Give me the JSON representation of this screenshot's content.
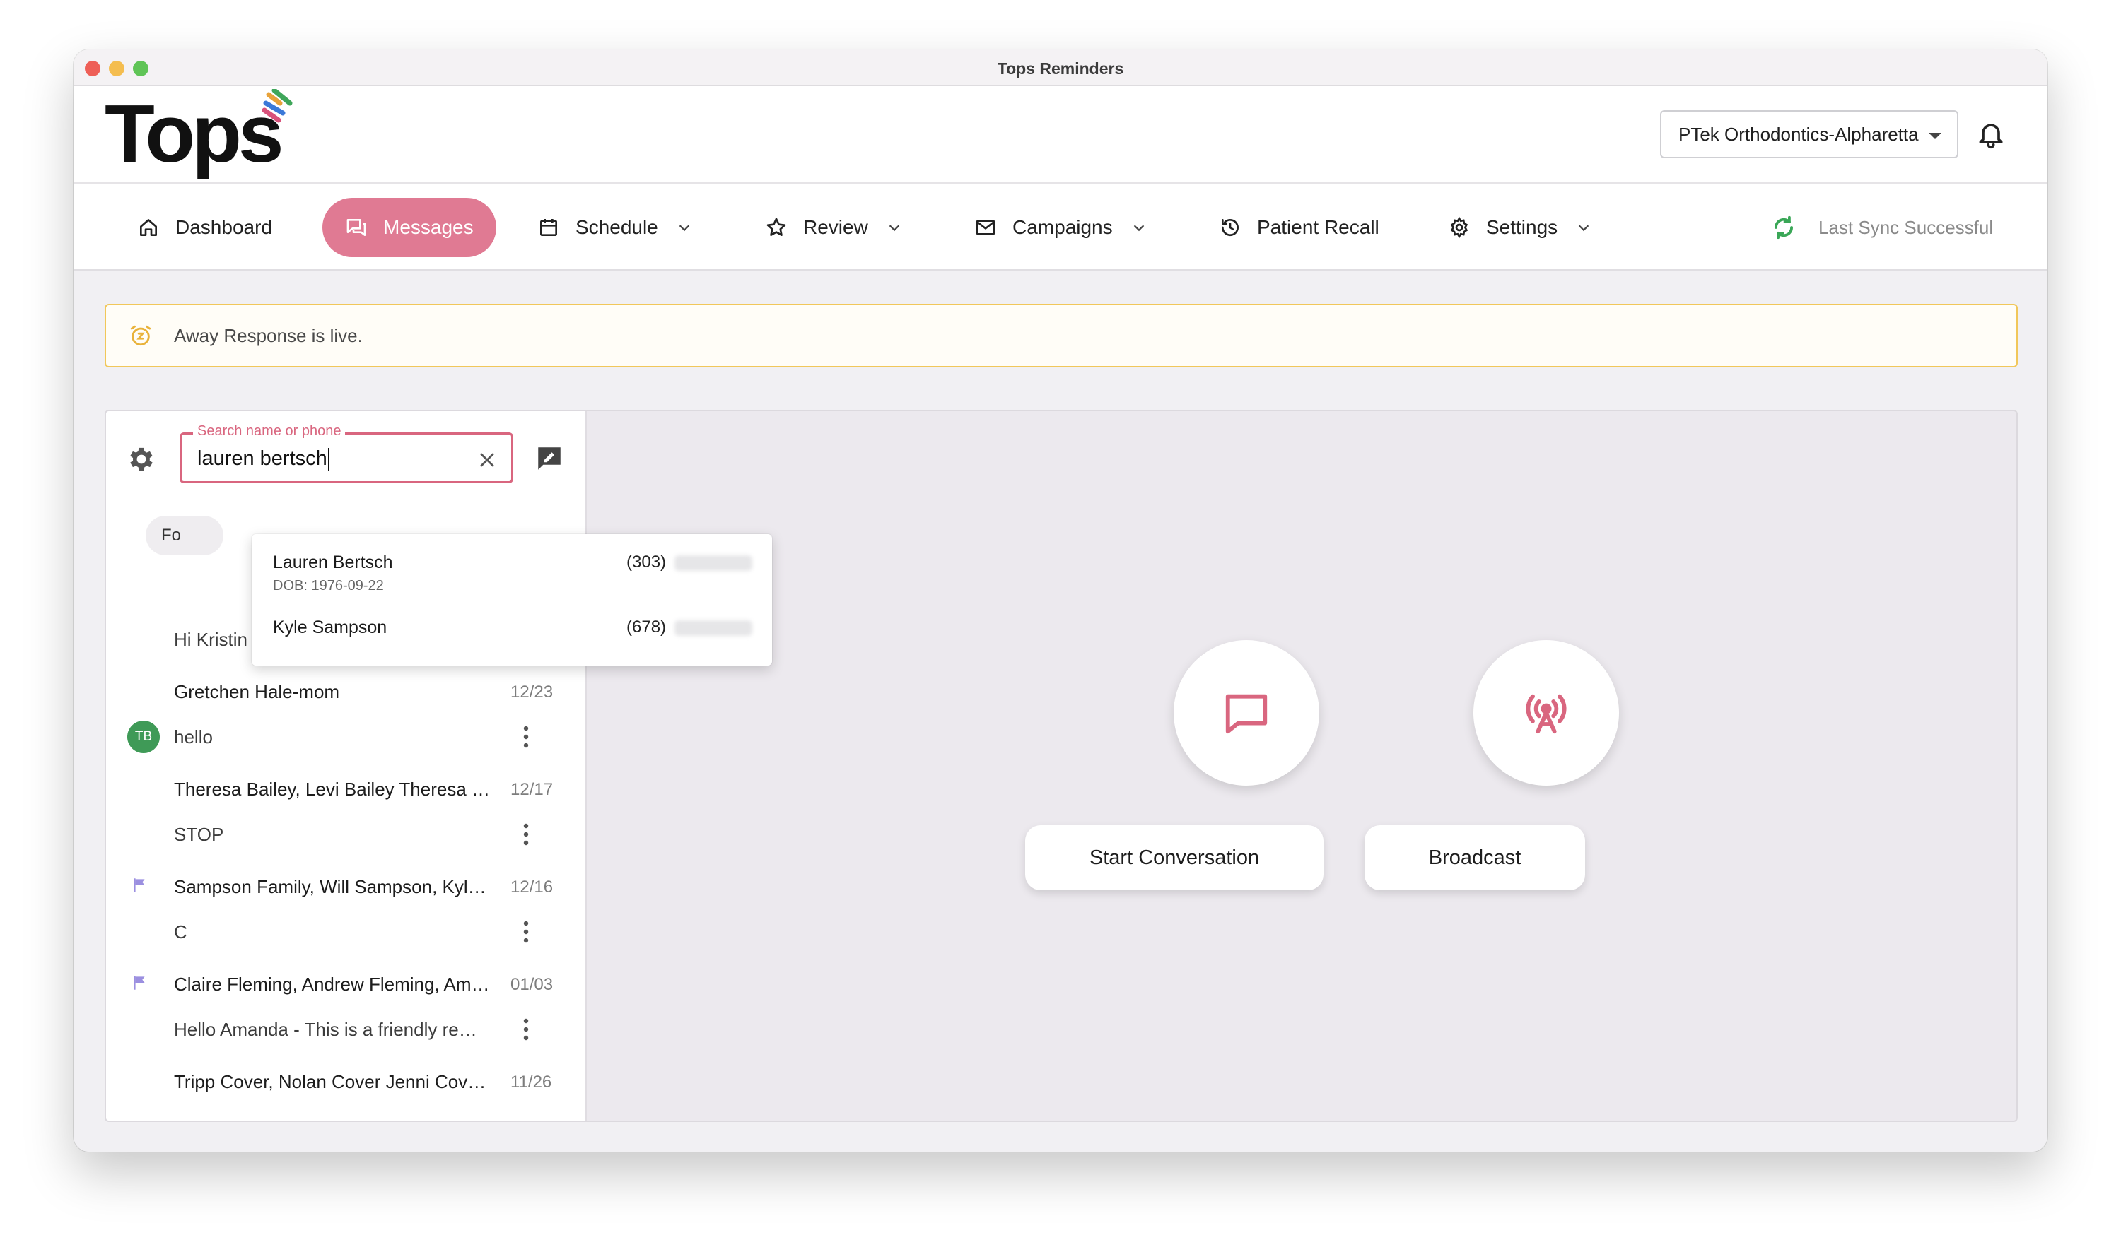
{
  "window": {
    "title": "Tops Reminders"
  },
  "header": {
    "logo_text": "Tops",
    "practice": "PTek Orthodontics-Alpharetta"
  },
  "nav": {
    "dashboard": "Dashboard",
    "messages": "Messages",
    "schedule": "Schedule",
    "review": "Review",
    "campaigns": "Campaigns",
    "patient_recall": "Patient Recall",
    "settings": "Settings",
    "sync_status": "Last Sync Successful"
  },
  "banner": {
    "text": "Away Response is live."
  },
  "search": {
    "placeholder": "Search name or phone",
    "value": "lauren bertsch"
  },
  "filter_chip": "Fo",
  "search_results": [
    {
      "name": "Lauren Bertsch",
      "dob": "DOB: 1976-09-22",
      "phone_prefix": "(303)"
    },
    {
      "name": "Kyle Sampson",
      "phone_prefix": "(678)"
    }
  ],
  "conversations": [
    {
      "name": "",
      "date": "",
      "message": "Hi Kristin ! We have a new textable number",
      "flag": false
    },
    {
      "name": "Gretchen Hale-mom",
      "date": "12/23",
      "message": "hello",
      "avatar": "TB",
      "flag": false
    },
    {
      "name": "Theresa Bailey, Levi Bailey Theresa Bailey",
      "date": "12/17",
      "message": "STOP",
      "flag": false
    },
    {
      "name": "Sampson Family, Will Sampson, Kyle Sampson",
      "date": "12/16",
      "message": "C",
      "flag": true
    },
    {
      "name": "Claire Fleming, Andrew Fleming, Amanda Fleming",
      "date": "01/03",
      "message": "Hello Amanda - This is a friendly reminder",
      "flag": true
    },
    {
      "name": "Tripp Cover, Nolan Cover Jenni Cover, Jenni",
      "date": "11/26",
      "message": "",
      "flag": false
    }
  ],
  "actions": {
    "start_conversation": "Start Conversation",
    "broadcast": "Broadcast"
  },
  "colors": {
    "accent": "#e07a93",
    "focus": "#d9667f",
    "banner_border": "#f1c75a",
    "flag": "#9b8fe0",
    "avatar": "#3f9a57",
    "sync": "#3aa757"
  },
  "icons": {
    "nav": [
      "home-icon",
      "chat-bubbles-icon",
      "calendar-icon",
      "star-icon",
      "mail-icon",
      "history-icon",
      "gear-icon"
    ],
    "actions": [
      "chat-bubble-icon",
      "broadcast-icon"
    ]
  }
}
